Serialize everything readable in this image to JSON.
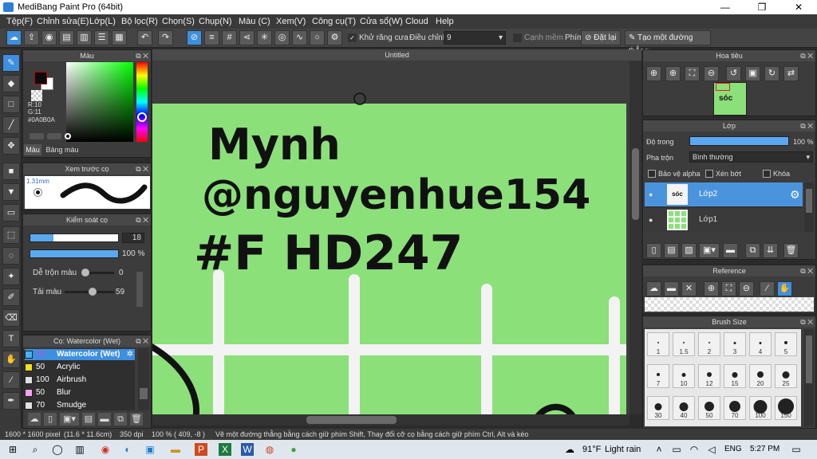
{
  "window": {
    "title": "MediBang Paint Pro (64bit)",
    "controls": [
      "—",
      "❐",
      "✕"
    ]
  },
  "menu": [
    "Tệp(F)",
    "Chỉnh sửa(E)",
    "Lớp(L)",
    "Bộ lọc(R)",
    "Chọn(S)",
    "Chụp(N)",
    "Màu (C)",
    "Xem(V)",
    "Công cụ(T)",
    "Cửa sổ(W)",
    "Cloud",
    "Help"
  ],
  "toolbar": {
    "antialias_label": "Khử răng cưa",
    "correction_label": "Điều chỉnh",
    "correction_value": "9",
    "soft_edge_label": "Cạnh mềm",
    "key_label": "Phím",
    "reset_label": "Đặt lại",
    "straight_line_label": "Tạo một đường thẳng"
  },
  "color_panel": {
    "title": "Màu",
    "rgb": [
      "R:10",
      "G:11"
    ],
    "hex": "#0A0B0A",
    "tab_color": "Màu",
    "tab_palette": "Bảng màu",
    "fg_color": "#0a0b0a",
    "bg_color": "#ffffff"
  },
  "brush_preview": {
    "title": "Xem trước cọ",
    "size": "1.31mm"
  },
  "brush_control": {
    "title": "Kiểm soát cọ",
    "size_value": "18",
    "size_level": 0.26,
    "opacity_value": "100 %",
    "opacity_level": 1.0,
    "blend_label": "Dễ trộn màu",
    "blend_value": "0",
    "amount_label": "Tải màu",
    "amount_value": "59"
  },
  "brush_list": {
    "title": "Cọ: Watercolor (Wet)",
    "items": [
      {
        "size": "18",
        "name": "Watercolor (Wet)",
        "color": "#4ab0f0",
        "selected": true
      },
      {
        "size": "50",
        "name": "Acrylic",
        "color": "#f0e020",
        "selected": false
      },
      {
        "size": "100",
        "name": "Airbrush",
        "color": "#e0e0e0",
        "selected": false
      },
      {
        "size": "50",
        "name": "Blur",
        "color": "#f8a0f0",
        "selected": false
      },
      {
        "size": "70",
        "name": "Smudge",
        "color": "#e0e0e0",
        "selected": false
      }
    ]
  },
  "document": {
    "tab": "Untitled",
    "handwriting": [
      "Mynh",
      "@nguyenhue154",
      "#F HD247"
    ],
    "canvas_color": "#8be07a"
  },
  "navigator": {
    "title": "Hoa tiêu"
  },
  "layer_panel": {
    "title": "Lớp",
    "opacity_label": "Độ trong",
    "opacity_value": "100 %",
    "blend_label": "Pha trộn",
    "blend_value": "Bình thường",
    "protect_alpha": "Bảo vệ alpha",
    "clipping": "Xén bớt",
    "lock": "Khóa",
    "layers": [
      {
        "name": "Lớp2",
        "selected": true
      },
      {
        "name": "Lớp1",
        "selected": false
      }
    ]
  },
  "reference": {
    "title": "Reference"
  },
  "brush_size": {
    "title": "Brush Size",
    "sizes": [
      "1",
      "1.5",
      "2",
      "3",
      "4",
      "5",
      "7",
      "10",
      "12",
      "15",
      "20",
      "25",
      "30",
      "40",
      "50",
      "70",
      "100",
      "150"
    ]
  },
  "status": {
    "dimensions": "1600 * 1600 pixel",
    "physical": "(11.6 * 11.6cm)",
    "dpi": "350 dpi",
    "zoom": "100 %",
    "coords": "( 409, -8 )",
    "hint": "Vẽ một đường thẳng bằng cách giữ phím Shift, Thay đổi cỡ cọ bằng cách giữ phím Ctrl, Alt và kéo"
  },
  "taskbar": {
    "weather_temp": "91°F",
    "weather_desc": "Light rain",
    "language": "ENG",
    "time": "5:27 PM"
  }
}
